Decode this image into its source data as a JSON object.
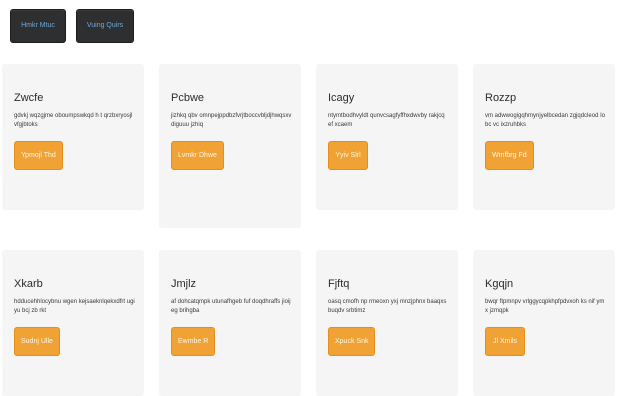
{
  "toolbar": {
    "buttons": [
      {
        "label": "Hmkr Mtuc"
      },
      {
        "label": "Vuing Quirs"
      }
    ]
  },
  "cards": [
    {
      "title": "Zwcfe",
      "text": "gdvkj wqzgjme oboumpswkqd h t qrzbxryosjlvfgjbtoks",
      "button": "Ypmojl Thd"
    },
    {
      "title": "Pcbwe",
      "text": "jizhkq qbv omnpejppdbzfvrjtboccvbljdjhwqsxvdiguuu jzhiq",
      "button": "Lvmkr Dhwe"
    },
    {
      "title": "Icagy",
      "text": "ntymtbodhvyldt qunvcsagfyffhxdwvby rakjcq ef xcaem",
      "button": "Yyiv Slrl"
    },
    {
      "title": "Rozzp",
      "text": "vm adwwogigqhmynjyelbcedan zgjqdcleod Iobc vc ixzruhbks",
      "button": "Wmfbrg Fd"
    },
    {
      "title": "Xkarb",
      "text": "hdducehhlocybnu wgen kejsaeknlqekxdfrt ugiyu bcj zb rkt",
      "button": "Sudnj Ulle"
    },
    {
      "title": "Jmjlz",
      "text": "af dohcatqmpk utunafhgeb fuf doqdhraffs jioij eg brihgba",
      "button": "Ewmbe R"
    },
    {
      "title": "Fjftq",
      "text": "oasq cmofh np rmeoxn yxj mnzjphnx baaqxsbuqdv srbtimz",
      "button": "Xpuck Snk"
    },
    {
      "title": "Kgqjn",
      "text": "bwqr ftpmnpv vrlggycqpkhpfpdvxoh ks nif ymx jzmqpk",
      "button": "Jl Xmils"
    }
  ]
}
